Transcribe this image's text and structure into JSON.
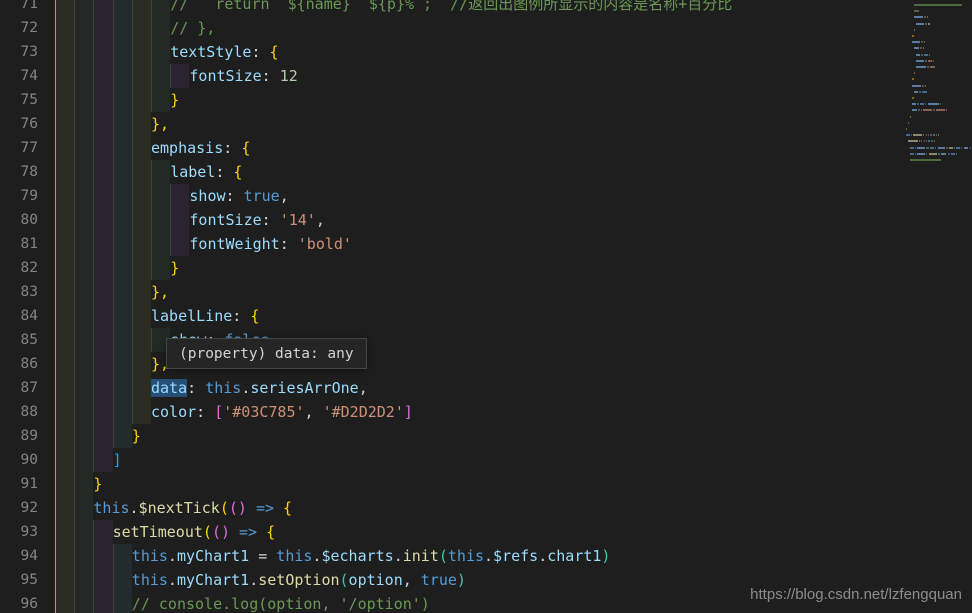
{
  "editor": {
    "app": "vscode-editor",
    "language": "javascript",
    "first_line_number": 71,
    "line_height": 24,
    "char_width": 9.6,
    "indent_size": 2
  },
  "colors": {
    "background": "#1e1e1e",
    "line_number": "#858585",
    "comment": "#6a9955",
    "property": "#9cdcfe",
    "string": "#ce9178",
    "number": "#b5cea8",
    "keyword": "#569cd6",
    "function": "#dcdcaa",
    "bracket_yellow": "#ffd700",
    "bracket_purple": "#da70d6",
    "bracket_blue": "#179fff",
    "indent_active_guide": "#c8a400",
    "selection_highlight": "#264f78",
    "tooltip_bg": "#252526",
    "tooltip_border": "#454545"
  },
  "lines": [
    {
      "n": 71,
      "indent": 0,
      "tokens": [
        {
          "t": "//   return `${name}  ${p}%`;  //返回出图例所显示的内容是名称+百分比",
          "c": "c-comment"
        }
      ]
    },
    {
      "n": 72,
      "indent": 0,
      "tokens": [
        {
          "t": "// },",
          "c": "c-comment"
        }
      ]
    },
    {
      "n": 73,
      "indent": 0,
      "tokens": [
        {
          "t": "textStyle",
          "c": "c-prop"
        },
        {
          "t": ": ",
          "c": "c-punc"
        },
        {
          "t": "{",
          "c": "c-brace-y"
        }
      ]
    },
    {
      "n": 74,
      "indent": 1,
      "tokens": [
        {
          "t": "fontSize",
          "c": "c-prop"
        },
        {
          "t": ": ",
          "c": "c-punc"
        },
        {
          "t": "12",
          "c": "c-num"
        }
      ]
    },
    {
      "n": 75,
      "indent": 0,
      "tokens": [
        {
          "t": "}",
          "c": "c-brace-y"
        }
      ]
    },
    {
      "n": 76,
      "indent": -1,
      "tokens": [
        {
          "t": "},",
          "c": "c-brace-y"
        }
      ]
    },
    {
      "n": 77,
      "indent": -1,
      "tokens": [
        {
          "t": "emphasis",
          "c": "c-prop"
        },
        {
          "t": ": ",
          "c": "c-punc"
        },
        {
          "t": "{",
          "c": "c-brace-y"
        }
      ]
    },
    {
      "n": 78,
      "indent": 0,
      "tokens": [
        {
          "t": "label",
          "c": "c-prop"
        },
        {
          "t": ": ",
          "c": "c-punc"
        },
        {
          "t": "{",
          "c": "c-brace-y"
        }
      ]
    },
    {
      "n": 79,
      "indent": 1,
      "tokens": [
        {
          "t": "show",
          "c": "c-prop"
        },
        {
          "t": ": ",
          "c": "c-punc"
        },
        {
          "t": "true",
          "c": "c-kw"
        },
        {
          "t": ",",
          "c": "c-punc"
        }
      ]
    },
    {
      "n": 80,
      "indent": 1,
      "tokens": [
        {
          "t": "fontSize",
          "c": "c-prop"
        },
        {
          "t": ": ",
          "c": "c-punc"
        },
        {
          "t": "'14'",
          "c": "c-str"
        },
        {
          "t": ",",
          "c": "c-punc"
        }
      ]
    },
    {
      "n": 81,
      "indent": 1,
      "tokens": [
        {
          "t": "fontWeight",
          "c": "c-prop"
        },
        {
          "t": ": ",
          "c": "c-punc"
        },
        {
          "t": "'bold'",
          "c": "c-str"
        }
      ]
    },
    {
      "n": 82,
      "indent": 0,
      "tokens": [
        {
          "t": "}",
          "c": "c-brace-y"
        }
      ]
    },
    {
      "n": 83,
      "indent": -1,
      "tokens": [
        {
          "t": "},",
          "c": "c-brace-y"
        }
      ]
    },
    {
      "n": 84,
      "indent": -1,
      "tokens": [
        {
          "t": "labelLine",
          "c": "c-prop"
        },
        {
          "t": ": ",
          "c": "c-punc"
        },
        {
          "t": "{",
          "c": "c-brace-y"
        }
      ]
    },
    {
      "n": 85,
      "indent": 0,
      "tokens": [
        {
          "t": "show",
          "c": "c-prop"
        },
        {
          "t": ": ",
          "c": "c-punc"
        },
        {
          "t": "false",
          "c": "c-kw"
        }
      ]
    },
    {
      "n": 86,
      "indent": -1,
      "tokens": [
        {
          "t": "},",
          "c": "c-brace-y"
        }
      ]
    },
    {
      "n": 87,
      "indent": -1,
      "tokens": [
        {
          "t": "data",
          "c": "c-prop hl-word"
        },
        {
          "t": ": ",
          "c": "c-punc"
        },
        {
          "t": "this",
          "c": "c-this"
        },
        {
          "t": ".",
          "c": "c-punc"
        },
        {
          "t": "seriesArrOne",
          "c": "c-prop"
        },
        {
          "t": ",",
          "c": "c-punc"
        }
      ]
    },
    {
      "n": 88,
      "indent": -1,
      "tokens": [
        {
          "t": "color",
          "c": "c-prop"
        },
        {
          "t": ": ",
          "c": "c-punc"
        },
        {
          "t": "[",
          "c": "c-brace-p"
        },
        {
          "t": "'#03C785'",
          "c": "c-str"
        },
        {
          "t": ", ",
          "c": "c-punc"
        },
        {
          "t": "'#D2D2D2'",
          "c": "c-str"
        },
        {
          "t": "]",
          "c": "c-brace-p"
        }
      ]
    },
    {
      "n": 89,
      "indent": -2,
      "tokens": [
        {
          "t": "}",
          "c": "c-brace-y"
        }
      ]
    },
    {
      "n": 90,
      "indent": -3,
      "tokens": [
        {
          "t": "]",
          "c": "c-brace-b"
        }
      ]
    },
    {
      "n": 91,
      "indent": -4,
      "tokens": [
        {
          "t": "}",
          "c": "c-brace-y"
        }
      ]
    },
    {
      "n": 92,
      "indent": -5,
      "tokens": [
        {
          "t": "this",
          "c": "c-this"
        },
        {
          "t": ".",
          "c": "c-punc"
        },
        {
          "t": "$nextTick",
          "c": "c-fn"
        },
        {
          "t": "(",
          "c": "c-paren-o"
        },
        {
          "t": "(",
          "c": "c-paren-p"
        },
        {
          "t": ")",
          "c": "c-paren-p"
        },
        {
          "t": " ",
          "c": "c-punc"
        },
        {
          "t": "=>",
          "c": "c-kw"
        },
        {
          "t": " ",
          "c": "c-punc"
        },
        {
          "t": "{",
          "c": "c-brace-y"
        }
      ]
    },
    {
      "n": 93,
      "indent": -4,
      "tokens": [
        {
          "t": "setTimeout",
          "c": "c-fn"
        },
        {
          "t": "(",
          "c": "c-paren-o"
        },
        {
          "t": "(",
          "c": "c-paren-p"
        },
        {
          "t": ")",
          "c": "c-paren-p"
        },
        {
          "t": " ",
          "c": "c-punc"
        },
        {
          "t": "=>",
          "c": "c-kw"
        },
        {
          "t": " ",
          "c": "c-punc"
        },
        {
          "t": "{",
          "c": "c-brace-y"
        }
      ]
    },
    {
      "n": 94,
      "indent": -3,
      "tokens": [
        {
          "t": "this",
          "c": "c-this"
        },
        {
          "t": ".",
          "c": "c-punc"
        },
        {
          "t": "myChart1",
          "c": "c-prop"
        },
        {
          "t": " = ",
          "c": "c-punc"
        },
        {
          "t": "this",
          "c": "c-this"
        },
        {
          "t": ".",
          "c": "c-punc"
        },
        {
          "t": "$echarts",
          "c": "c-prop"
        },
        {
          "t": ".",
          "c": "c-punc"
        },
        {
          "t": "init",
          "c": "c-fn"
        },
        {
          "t": "(",
          "c": "c-paren-g"
        },
        {
          "t": "this",
          "c": "c-this"
        },
        {
          "t": ".",
          "c": "c-punc"
        },
        {
          "t": "$refs",
          "c": "c-prop"
        },
        {
          "t": ".",
          "c": "c-punc"
        },
        {
          "t": "chart1",
          "c": "c-prop"
        },
        {
          "t": ")",
          "c": "c-paren-g"
        }
      ]
    },
    {
      "n": 95,
      "indent": -3,
      "tokens": [
        {
          "t": "this",
          "c": "c-this"
        },
        {
          "t": ".",
          "c": "c-punc"
        },
        {
          "t": "myChart1",
          "c": "c-prop"
        },
        {
          "t": ".",
          "c": "c-punc"
        },
        {
          "t": "setOption",
          "c": "c-fn"
        },
        {
          "t": "(",
          "c": "c-paren-g"
        },
        {
          "t": "option",
          "c": "c-prop"
        },
        {
          "t": ", ",
          "c": "c-punc"
        },
        {
          "t": "true",
          "c": "c-kw"
        },
        {
          "t": ")",
          "c": "c-paren-g"
        }
      ]
    },
    {
      "n": 96,
      "indent": -3,
      "tokens": [
        {
          "t": "// console.log(option, '/option')",
          "c": "c-comment"
        }
      ]
    }
  ],
  "tooltip": {
    "text": "(property) data: any",
    "visible": true
  },
  "watermark": {
    "text": "https://blog.csdn.net/lzfengquan"
  }
}
